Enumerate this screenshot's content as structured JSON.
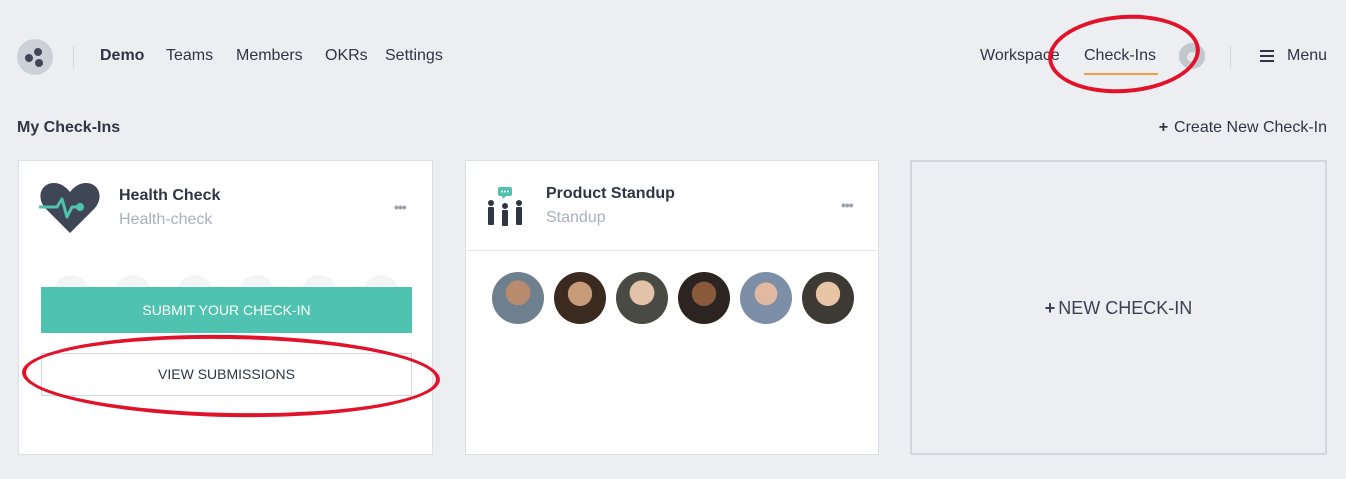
{
  "nav": {
    "workspace_name": "Demo",
    "links": [
      "Teams",
      "Members",
      "OKRs",
      "Settings"
    ],
    "right_links": {
      "workspace": "Workspace",
      "checkins": "Check-Ins"
    },
    "menu_label": "Menu",
    "active_color": "#f0a046"
  },
  "section": {
    "title": "My Check-Ins",
    "create_label": "Create New Check-In"
  },
  "cards": [
    {
      "icon": "heart-pulse-icon",
      "title": "Health Check",
      "subtitle": "Health-check",
      "submit_label": "SUBMIT YOUR CHECK-IN",
      "view_label": "VIEW SUBMISSIONS",
      "accent": "#4fc3b0"
    },
    {
      "icon": "team-standup-icon",
      "title": "Product Standup",
      "subtitle": "Standup",
      "member_count": 6
    }
  ],
  "new_checkin_label": "NEW CHECK-IN",
  "annotation_color": "#e3122b"
}
